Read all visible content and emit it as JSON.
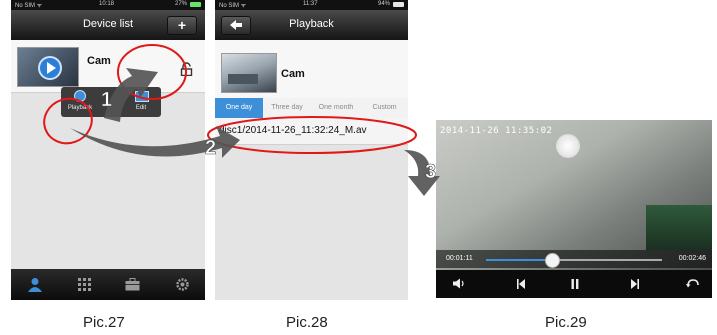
{
  "pic27": {
    "status": {
      "carrier": "No SIM ᯤ",
      "time": "10:18",
      "battery": "27%"
    },
    "nav": {
      "title": "Device list",
      "add_label": "+"
    },
    "device": {
      "name": "Cam"
    },
    "menu": {
      "playback_label": "Playback",
      "edit_label": "Edit"
    },
    "caption": "Pic.27",
    "icons": [
      "camera-thumbnail",
      "lock-icon",
      "playback-icon",
      "edit-icon",
      "user-icon",
      "grid-icon",
      "toolbox-icon",
      "gear-icon"
    ]
  },
  "pic28": {
    "status": {
      "carrier": "No SIM ᯤ",
      "time": "11:37",
      "battery": "94%"
    },
    "nav": {
      "title": "Playback",
      "back_label": "back-arrow"
    },
    "device": {
      "name": "Cam"
    },
    "tabs": [
      {
        "label": "One day",
        "selected": true
      },
      {
        "label": "Three day",
        "selected": false
      },
      {
        "label": "One month",
        "selected": false
      },
      {
        "label": "Custom",
        "selected": false
      }
    ],
    "file": "disc1/2014-11-26_11:32:24_M.av",
    "caption": "Pic.28"
  },
  "pic29": {
    "timestamp": "2014-11-26  11:35:02",
    "elapsed": "00:01:11",
    "total": "00:02:46",
    "progress": 0.37,
    "caption": "Pic.29",
    "icons": [
      "volume-icon",
      "previous-icon",
      "pause-icon",
      "next-icon",
      "return-icon"
    ]
  },
  "steps": [
    "1",
    "2",
    "3"
  ],
  "colors": {
    "accent": "#3d8fd9",
    "highlight_circle": "#e01818",
    "arrow": "#555555"
  }
}
